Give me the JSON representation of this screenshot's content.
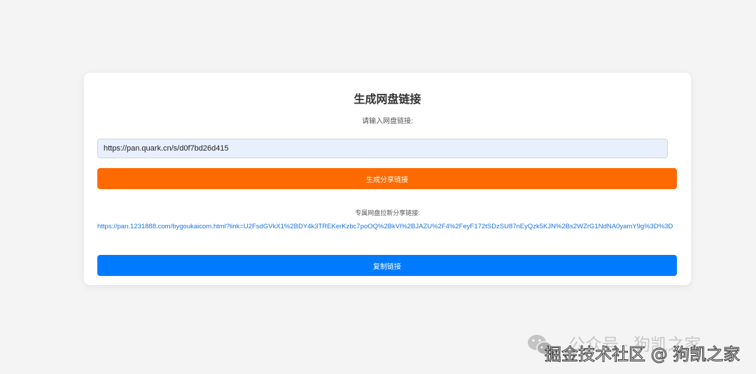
{
  "form": {
    "title": "生成网盘链接",
    "input_label": "请输入网盘链接:",
    "input_value": "https://pan.quark.cn/s/d0f7bd26d415",
    "generate_label": "生成分享链接",
    "result_label": "专属网盘拉新分享链接:",
    "result_link": "https://pan.1231888.com/bygoukaicom.html?link=U2FsdGVkX1%2BDY4k3TREKerKzbc7poOQ%2BkVl%2BJAZU%2F4%2FeyF172tSDzSU87nEyQzk5KJN%2Bs2WZrG1NdNA0yamY9g%3D%3D",
    "copy_label": "复制链接"
  },
  "watermark": {
    "sub": "公众号 · 狗凯之家",
    "main": "掘金技术社区 @ 狗凯之家"
  },
  "colors": {
    "generate": "#ff6a00",
    "copy": "#007bff",
    "link": "#1a73e8"
  }
}
